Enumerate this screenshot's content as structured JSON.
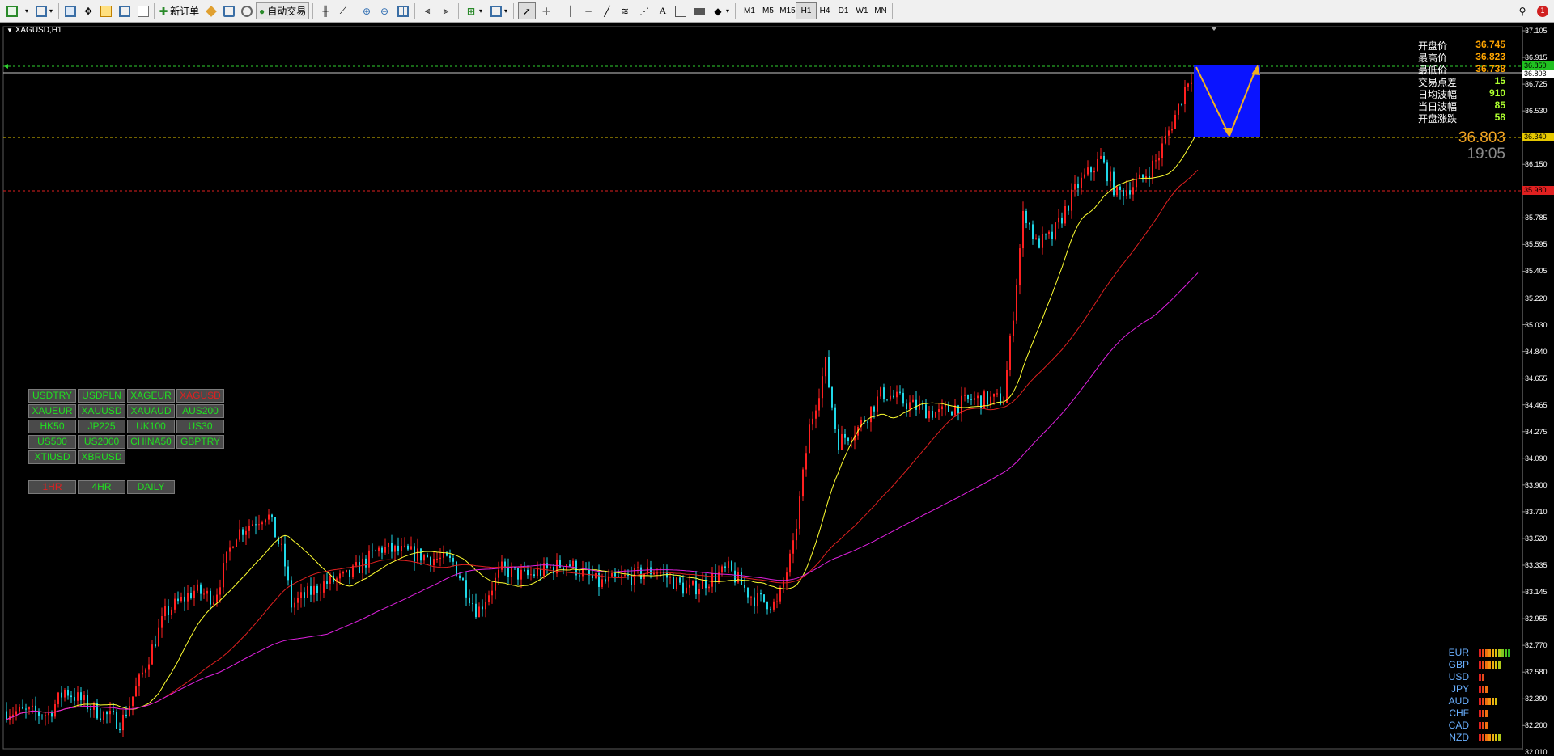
{
  "toolbar": {
    "new_order_label": "新订单",
    "auto_trade_label": "自动交易",
    "timeframes": [
      "M1",
      "M5",
      "M15",
      "H1",
      "H4",
      "D1",
      "W1",
      "MN"
    ],
    "active_timeframe": "H1",
    "notification_count": "1"
  },
  "chart": {
    "title": "XAGUSD,H1",
    "price_axis": [
      "37.105",
      "36.915",
      "36.725",
      "36.530",
      "36.340",
      "36.150",
      "35.965",
      "35.785",
      "35.595",
      "35.405",
      "35.220",
      "35.030",
      "34.840",
      "34.655",
      "34.465",
      "34.275",
      "34.090",
      "33.900",
      "33.710",
      "33.520",
      "33.335",
      "33.145",
      "32.955",
      "32.770",
      "32.580",
      "32.390",
      "32.200",
      "32.010"
    ],
    "price_labels": {
      "high_line": "36.850",
      "current": "36.803",
      "yellow_line": "36.340",
      "red_line": "35.980"
    }
  },
  "info_panel": [
    {
      "label": "开盘价",
      "value": "36.745",
      "color": "#ffa500"
    },
    {
      "label": "最高价",
      "value": "36.823",
      "color": "#ffa500"
    },
    {
      "label": "最低价",
      "value": "36.738",
      "color": "#ffa500"
    },
    {
      "label": "交易点差",
      "value": "15",
      "color": "#adff2f"
    },
    {
      "label": "日均波幅",
      "value": "910",
      "color": "#adff2f"
    },
    {
      "label": "当日波幅",
      "value": "85",
      "color": "#adff2f"
    },
    {
      "label": "开盘涨跌",
      "value": "58",
      "color": "#adff2f"
    }
  ],
  "big_price": "36.803",
  "big_time": "19:05",
  "symbols": [
    "USDTRY",
    "USDPLN",
    "XAGEUR",
    "XAGUSD",
    "XAUEUR",
    "XAUUSD",
    "XAUAUD",
    "AUS200",
    "HK50",
    "JP225",
    "UK100",
    "US30",
    "US500",
    "US2000",
    "CHINA50",
    "GBPTRY",
    "XTIUSD",
    "XBRUSD"
  ],
  "active_symbol": "XAGUSD",
  "periods": [
    "1HR",
    "4HR",
    "DAILY"
  ],
  "active_period": "1HR",
  "currency_strength": [
    {
      "currency": "EUR",
      "level": 10
    },
    {
      "currency": "GBP",
      "level": 7
    },
    {
      "currency": "USD",
      "level": 2
    },
    {
      "currency": "JPY",
      "level": 3
    },
    {
      "currency": "AUD",
      "level": 6
    },
    {
      "currency": "CHF",
      "level": 3
    },
    {
      "currency": "CAD",
      "level": 3
    },
    {
      "currency": "NZD",
      "level": 7
    }
  ]
}
